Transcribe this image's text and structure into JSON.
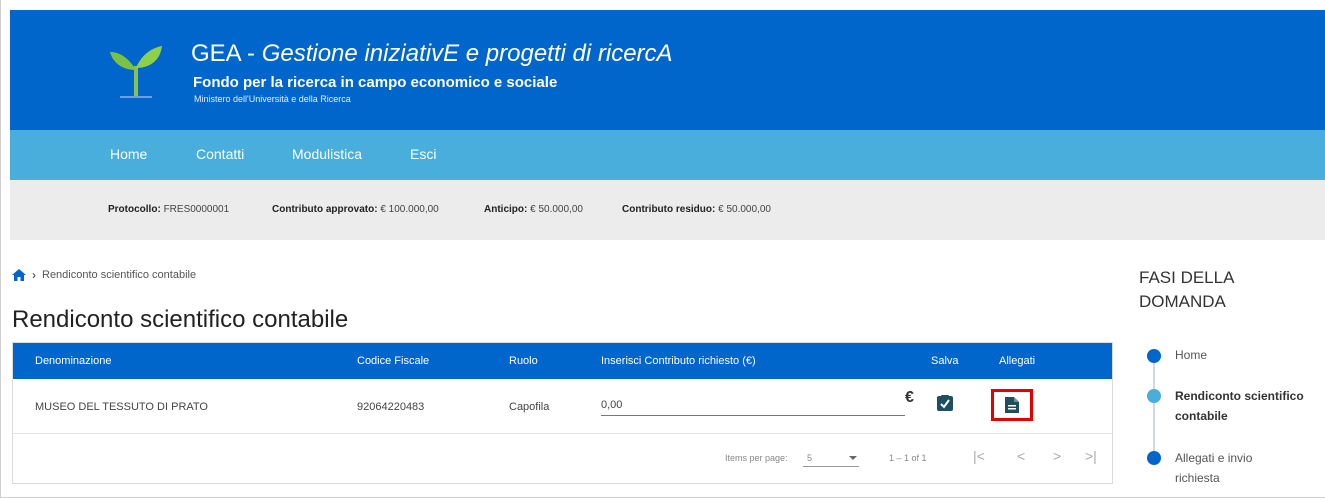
{
  "header": {
    "title_prefix": "GEA - ",
    "title_italic": "Gestione iniziativE e progetti di ricercA",
    "subtitle": "Fondo per la ricerca in campo economico e sociale",
    "ministry": "Ministero dell'Università e della Ricerca"
  },
  "nav": {
    "items": [
      {
        "label": "Home"
      },
      {
        "label": "Contatti"
      },
      {
        "label": "Modulistica"
      },
      {
        "label": "Esci"
      }
    ]
  },
  "info": {
    "protocollo_key": "Protocollo:",
    "protocollo_val": "FRES0000001",
    "approvato_key": "Contributo approvato:",
    "approvato_val": "€ 100.000,00",
    "anticipo_key": "Anticipo:",
    "anticipo_val": "€ 50.000,00",
    "residuo_key": "Contributo residuo:",
    "residuo_val": "€ 50.000,00"
  },
  "breadcrumb": {
    "current": "Rendiconto scientifico contabile"
  },
  "page_title": "Rendiconto scientifico contabile",
  "table": {
    "headers": {
      "denominazione": "Denominazione",
      "codice_fiscale": "Codice Fiscale",
      "ruolo": "Ruolo",
      "contributo": "Inserisci Contributo richiesto (€)",
      "salva": "Salva",
      "allegati": "Allegati"
    },
    "rows": [
      {
        "denominazione": "MUSEO DEL TESSUTO DI PRATO",
        "codice_fiscale": "92064220483",
        "ruolo": "Capofila",
        "contributo": "0,00",
        "currency": "€"
      }
    ],
    "footer": {
      "items_per_page_label": "Items per page:",
      "items_per_page_value": "5",
      "range": "1 – 1 of 1",
      "first": "|<",
      "prev": "<",
      "next": ">",
      "last": ">|"
    }
  },
  "phases": {
    "title_line1": "FASI DELLA",
    "title_line2": "DOMANDA",
    "steps": [
      {
        "label": "Home"
      },
      {
        "label_line1": "Rendiconto scientifico",
        "label_line2": "contabile"
      },
      {
        "label_line1": "Allegati e invio",
        "label_line2": "richiesta"
      }
    ]
  },
  "colors": {
    "header_blue": "#0066cc",
    "nav_light_blue": "#4aaedc",
    "info_gray": "#ececec",
    "highlight_red": "#e60000",
    "step_active": "#4aaedc",
    "step_done": "#0066cc"
  }
}
